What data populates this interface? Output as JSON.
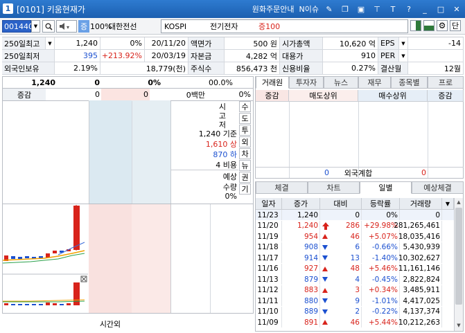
{
  "title": {
    "number": "1",
    "screen": "[0101] 키움현재가",
    "links": [
      "원화주문안내",
      "N이슈"
    ]
  },
  "toolbar": {
    "code": "001440",
    "margin_badge": "증",
    "margin_rate": "100%",
    "stock_name": "대한전선",
    "search": {
      "market": "KOSPI",
      "name": "전기전자",
      "margin": "증100"
    },
    "ratio_btn": "단"
  },
  "info": {
    "r1": {
      "l1": "250일최고",
      "v1": "1,240",
      "p1": "0%",
      "d1": "20/11/20",
      "l2": "액면가",
      "v2": "500 원",
      "l3": "시가총액",
      "v3": "10,620 억",
      "l4": "EPS",
      "v4": "-14"
    },
    "r2": {
      "l1": "250일최저",
      "v1": "395",
      "p1": "+213.92%",
      "d1": "20/03/19",
      "l2": "자본금",
      "v2": "4,282 억",
      "l3": "대용가",
      "v3": "910",
      "l4": "PER",
      "v4": ""
    },
    "r3": {
      "l1": "외국인보유",
      "v1": "2.19%",
      "d1": "18,779(천)",
      "l2": "주식수",
      "v2": "856,473 천",
      "l3": "신용비율",
      "v3": "0.27%",
      "l4": "결산월",
      "v4": "12월"
    }
  },
  "quote": {
    "price": "1,240",
    "zero1": "0",
    "zero2": "0%",
    "zero3": "0",
    "zero4": "0.0%",
    "chg_label": "증감",
    "chg_v1": "0",
    "chg_v2": "0",
    "chg_v3": "0백만",
    "chg_v4": "0%"
  },
  "book_info": {
    "lines": [
      "시",
      "고",
      "저",
      "1,240 기준",
      "1,610 상",
      "870 하",
      "4 비용",
      "예상",
      "수량",
      "0%"
    ]
  },
  "vtabs": [
    "수",
    "도",
    "투",
    "외",
    "차",
    "뉴",
    "권",
    "기"
  ],
  "lower": {
    "bottom_label": "시간외"
  },
  "right_tabs": {
    "top": [
      "거래원",
      "투자자",
      "뉴스",
      "재무",
      "종목별",
      "프로"
    ],
    "head": {
      "c1": "증감",
      "c2": "매도상위",
      "c3": "매수상위",
      "c4": "증감"
    },
    "foreign": {
      "v1": "0",
      "label": "외국계합",
      "v2": "0"
    },
    "bottom": [
      "체결",
      "차트",
      "일별",
      "예상체결"
    ]
  },
  "daily": {
    "headers": [
      "일자",
      "증가",
      "대비",
      "등락률",
      "거래량"
    ],
    "rows": [
      {
        "date": "11/23",
        "close": "1,240",
        "diff": "0",
        "rate": "0%",
        "vol": "0",
        "dir": "none"
      },
      {
        "date": "11/20",
        "close": "1,240",
        "diff": "286",
        "rate": "+29.98%",
        "vol": "281,265,461",
        "dir": "upper"
      },
      {
        "date": "11/19",
        "close": "954",
        "diff": "46",
        "rate": "+5.07%",
        "vol": "18,035,416",
        "dir": "up"
      },
      {
        "date": "11/18",
        "close": "908",
        "diff": "6",
        "rate": "-0.66%",
        "vol": "5,430,939",
        "dir": "down"
      },
      {
        "date": "11/17",
        "close": "914",
        "diff": "13",
        "rate": "-1.40%",
        "vol": "10,302,627",
        "dir": "down"
      },
      {
        "date": "11/16",
        "close": "927",
        "diff": "48",
        "rate": "+5.46%",
        "vol": "11,161,146",
        "dir": "up"
      },
      {
        "date": "11/13",
        "close": "879",
        "diff": "4",
        "rate": "-0.45%",
        "vol": "2,822,824",
        "dir": "down"
      },
      {
        "date": "11/12",
        "close": "883",
        "diff": "3",
        "rate": "+0.34%",
        "vol": "3,485,911",
        "dir": "up"
      },
      {
        "date": "11/11",
        "close": "880",
        "diff": "9",
        "rate": "-1.01%",
        "vol": "4,417,025",
        "dir": "down"
      },
      {
        "date": "11/10",
        "close": "889",
        "diff": "2",
        "rate": "-0.22%",
        "vol": "4,137,374",
        "dir": "down"
      },
      {
        "date": "11/09",
        "close": "891",
        "diff": "46",
        "rate": "+5.44%",
        "vol": "10,212,263",
        "dir": "up"
      }
    ]
  },
  "colors": {
    "up": "#d8231b",
    "down": "#1b50d0",
    "header": "#1c5fb0"
  }
}
